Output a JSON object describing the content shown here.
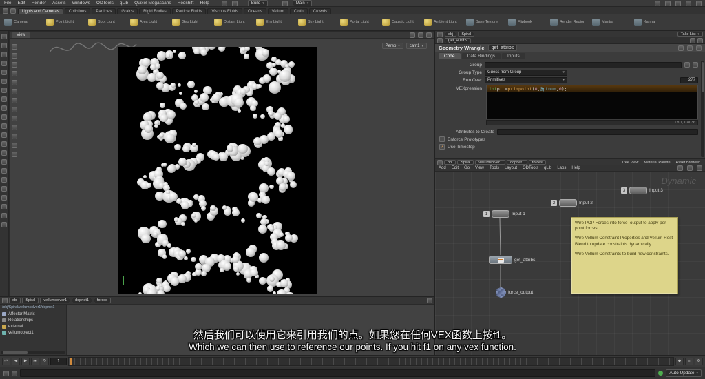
{
  "menubar": {
    "items": [
      "File",
      "Edit",
      "Render",
      "Assets",
      "Windows",
      "ODTools",
      "qLib",
      "Quixel Megascans",
      "Redshift",
      "Help"
    ],
    "build": "Build",
    "main": "Main"
  },
  "shelf": {
    "tabs": [
      "Lights and Cameras",
      "Collisions",
      "Particles",
      "Grains",
      "Rigid Bodies",
      "Particle Fluids",
      "Viscous Fluids",
      "Oceans",
      "Vellum",
      "Cloth",
      "Crowds"
    ],
    "tools": [
      "Camera",
      "Point Light",
      "Spot Light",
      "Area Light",
      "Geo Light",
      "Distant Light",
      "Env Light",
      "Sky Light",
      "Portal Light",
      "Caustic Light",
      "Ambient Light",
      "Bake Texture",
      "Flipbook",
      "Render Region",
      "Mantra",
      "Karma"
    ]
  },
  "viewport": {
    "tab": "View",
    "persp": "Persp",
    "cam": "cam1"
  },
  "wrangle": {
    "path_tabs": [
      "obj",
      "Spiral"
    ],
    "take_list": "Take List",
    "node_pill": "get_attribs",
    "title": "Geometry Wrangle",
    "node": "get_attribs",
    "tabs": [
      "Code",
      "Data Bindings",
      "Inputs"
    ],
    "group_label": "Group",
    "group_type_label": "Group Type",
    "group_type_value": "Guess from Group",
    "run_over_label": "Run Over",
    "run_over_value": "Primitives",
    "run_over_count": "277",
    "vex_label": "VEXpression",
    "code_tokens": [
      {
        "text": "int ",
        "color": "#5db75d"
      },
      {
        "text": "pt = ",
        "color": "#d8d8d8"
      },
      {
        "text": "primpoint",
        "color": "#dca455"
      },
      {
        "text": "(",
        "color": "#d8d8d8"
      },
      {
        "text": "0",
        "color": "#c393b0"
      },
      {
        "text": ", ",
        "color": "#d8d8d8"
      },
      {
        "text": "@ptnum",
        "color": "#7fc4de"
      },
      {
        "text": ", ",
        "color": "#d8d8d8"
      },
      {
        "text": "0",
        "color": "#c393b0"
      },
      {
        "text": ");",
        "color": "#d8d8d8"
      }
    ],
    "cursor": "Ln 1, Col 36",
    "attribs_label": "Attributes to Create",
    "enforce_label": "Enforce Prototypes",
    "timestep_label": "Use Timestep"
  },
  "middle_tabs": {
    "path": [
      "obj",
      "Spiral",
      "vellumsolver1",
      "dopnet1",
      "forces"
    ],
    "tabs": [
      "Tree View",
      "Material Palette",
      "Asset Browser"
    ]
  },
  "network": {
    "menu": [
      "Add",
      "Edit",
      "Go",
      "View",
      "Tools",
      "Layout",
      "ODTools",
      "qLib",
      "Labs",
      "Help"
    ],
    "nodes": {
      "input1": "Input 1",
      "input1_num": "1",
      "input2": "Input 2",
      "input2_num": "2",
      "input3": "Input 3",
      "input3_num": "3",
      "wrangle": "get_attribs",
      "force": "force_output"
    },
    "sticky": {
      "p1": "Wire POP Forces into force_output to apply per-point forces.",
      "p2": "Wire Vellum Constraint Properties and Vellum Rest Blend to update constraints dynamically.",
      "p3": "Wire Vellum Constraints to build new constraints."
    },
    "watermark": "Dynamic"
  },
  "bottom_left": {
    "tabs": [
      "obj",
      "Spiral",
      "vellumsolver1",
      "dopnet1",
      "forces"
    ],
    "path": "/obj/Spiral/vellumsolver1/dopnet1",
    "items": [
      "Affector Matrix",
      "Relationships",
      "external",
      "vellumobject1"
    ]
  },
  "subtitles": {
    "zh": "然后我们可以使用它来引用我们的点。如果您在任何VEX函数上按f1。",
    "en": "Which we can then use to reference our points. If you hit f1 on any vex function."
  },
  "timeline": {
    "current": "1"
  },
  "statusbar": {
    "right": "Auto Update"
  }
}
